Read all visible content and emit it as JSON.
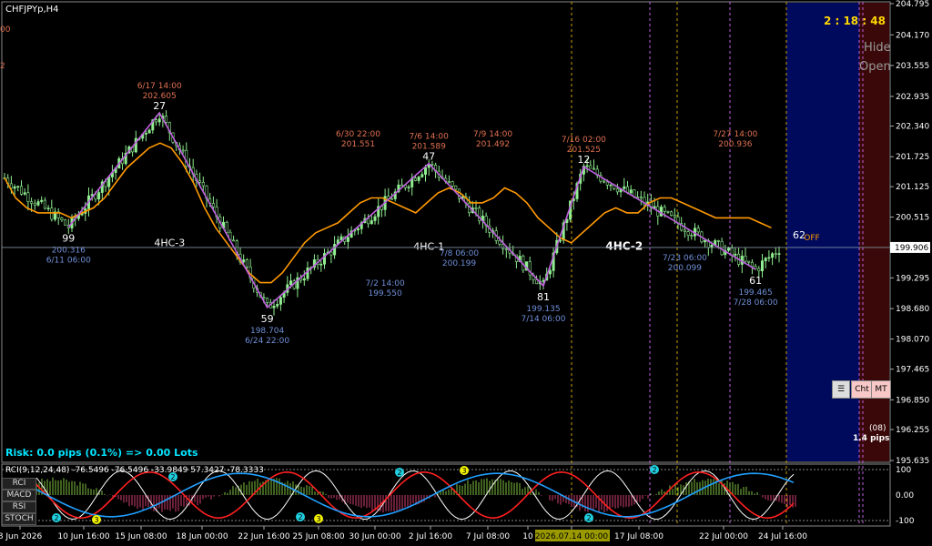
{
  "window": {
    "symbol": "CHFJPYp,H4",
    "timer": "2 : 18 : 48",
    "hide_label": "Hide",
    "open_label": "Open",
    "left_top_1": "00",
    "left_top_2": "2"
  },
  "price_axis": {
    "ticks": [
      "204.795",
      "204.170",
      "203.555",
      "202.935",
      "202.340",
      "201.725",
      "201.125",
      "200.515",
      "199.906",
      "199.295",
      "198.680",
      "198.070",
      "197.465",
      "196.850",
      "196.255",
      "195.635"
    ],
    "current_price": "199.906"
  },
  "time_axis": {
    "labels": [
      "8 Jun 2026",
      "10 Jun 16:00",
      "15 Jun 08:00",
      "18 Jun 00:00",
      "22 Jun 16:00",
      "25 Jun 08:00",
      "30 Jun 00:00",
      "2 Jul 16:00",
      "7 Jul 08:00",
      "10",
      "2026.07.14 00:00",
      "17 Jul 08:00",
      "22 Jul 00:00",
      "24 Jul 16:00"
    ]
  },
  "colors": {
    "background": "#000000",
    "zigzag": "#c060e0",
    "moving_average": "#ff9900",
    "candle": "#90ee90",
    "date_label": "#e07050",
    "low_label": "#6f8fd8",
    "future_panel": "#000a5c",
    "right_panel": "#3a0808",
    "risk_text": "#00e5ff"
  },
  "chart_data": {
    "type": "line",
    "y_range": [
      195.635,
      204.795
    ],
    "x_range": [
      0,
      235
    ],
    "pivots": [
      {
        "x": 19,
        "value": 200.316,
        "count": "99",
        "price": "200.316",
        "date": "6/11 06:00",
        "kind": "low"
      },
      {
        "x": 46,
        "value": 202.605,
        "count": "27",
        "price": "202.605",
        "date": "6/17 14:00",
        "kind": "high"
      },
      {
        "x": 78,
        "value": 198.704,
        "count": "59",
        "price": "198.704",
        "date": "6/24 22:00",
        "kind": "low"
      },
      {
        "x": 126,
        "value": 201.589,
        "count": "47",
        "price": "201.589",
        "date": "7/6 14:00",
        "kind": "high"
      },
      {
        "x": 160,
        "value": 199.135,
        "count": "81",
        "price": "199.135",
        "date": "7/14 06:00",
        "kind": "low"
      },
      {
        "x": 172,
        "value": 201.525,
        "count": "12",
        "price": "201.525",
        "date": "7/16 02:00",
        "kind": "high"
      },
      {
        "x": 223,
        "value": 199.465,
        "count": "61",
        "price": "199.465",
        "date": "7/28 06:00",
        "kind": "low"
      }
    ],
    "extra_price_labels": [
      {
        "x": 105,
        "price": "201.551",
        "date": "6/30 22:00",
        "kind": "high"
      },
      {
        "x": 145,
        "price": "201.492",
        "date": "7/9 14:00",
        "kind": "high"
      },
      {
        "x": 217,
        "price": "200.936",
        "date": "7/27 14:00",
        "kind": "high"
      },
      {
        "x": 113,
        "price": "199.550",
        "date": "7/2 14:00",
        "kind": "low"
      },
      {
        "x": 135,
        "price": "200.199",
        "date": "7/8 06:00",
        "kind": "low"
      },
      {
        "x": 202,
        "price": "200.099",
        "date": "7/23 06:00",
        "kind": "low"
      }
    ],
    "cycle_labels": [
      {
        "x": 49,
        "value": 199.93,
        "text": "4HC-3"
      },
      {
        "x": 126,
        "value": 199.86,
        "text": "4HC-1"
      },
      {
        "x": 184,
        "value": 199.86,
        "text": "4HC-2"
      }
    ],
    "last_count": "62",
    "off_label": "OFF",
    "ma_values": [
      201.3,
      200.9,
      200.7,
      200.6,
      200.6,
      200.6,
      200.5,
      200.6,
      200.7,
      200.9,
      201.2,
      201.5,
      201.7,
      201.9,
      202.0,
      201.9,
      201.6,
      201.2,
      200.7,
      200.3,
      200.0,
      199.7,
      199.4,
      199.2,
      199.2,
      199.4,
      199.7,
      200.0,
      200.2,
      200.3,
      200.4,
      200.6,
      200.8,
      200.9,
      200.9,
      200.8,
      200.7,
      200.6,
      200.8,
      201.0,
      201.1,
      201.0,
      200.8,
      200.8,
      200.9,
      201.1,
      201.0,
      200.8,
      200.5,
      200.3,
      200.1,
      200.0,
      200.2,
      200.4,
      200.6,
      200.7,
      200.6,
      200.6,
      200.8,
      200.9,
      200.9,
      200.8,
      200.7,
      200.6,
      200.5,
      200.5,
      200.5,
      200.5,
      200.4,
      200.3
    ],
    "ma_start_x": 0,
    "ma_step": 3.3,
    "candle_seed": 7
  },
  "risk_text": "Risk: 0.0 pips (0.1%) => 0.00 Lots",
  "pips_line_1": "(08)",
  "pips_line_2": "1.4 pips",
  "panel_buttons": {
    "cht": "Cht",
    "mt": "MT"
  },
  "indicator": {
    "title": "RCI(9,12,24,48) -76.5496 -76.5496 -33.9849 57.3427 -78.3333",
    "buttons": [
      "RCI",
      "MACD",
      "RSI",
      "STOCH"
    ],
    "axis_ticks": [
      "100",
      "0.00",
      "-100"
    ]
  }
}
